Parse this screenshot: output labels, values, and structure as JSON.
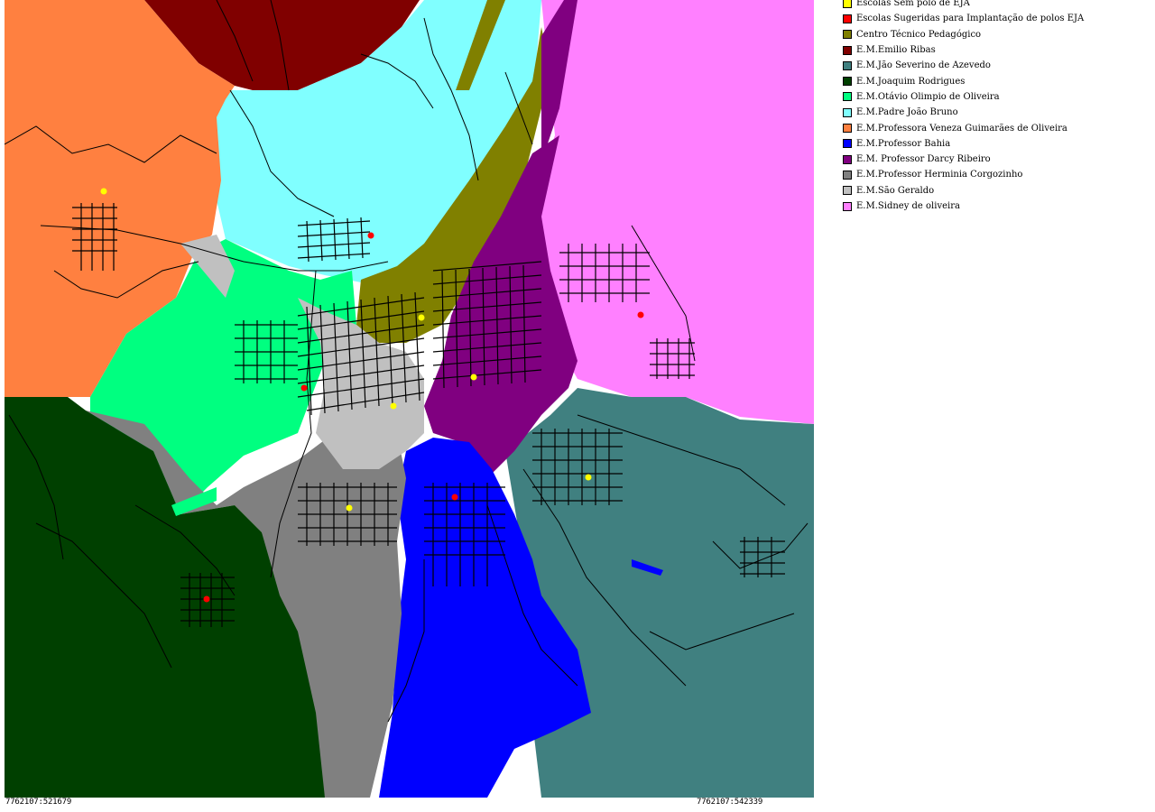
{
  "map": {
    "coord_bottom_left": "7762107:521679",
    "coord_bottom_right": "7762107:542339",
    "colors": {
      "background": "#ffffff",
      "streets": "#000000",
      "school_no_eja": "#ffff00",
      "school_suggested_eja": "#ff0000"
    }
  },
  "legend": {
    "items": [
      {
        "label": "Escolas Sem polo de EJA",
        "color": "#ffff00"
      },
      {
        "label": "Escolas Sugeridas para Implantação de polos EJA",
        "color": "#ff0000"
      },
      {
        "label": "Centro Técnico Pedagógico",
        "color": "#808000"
      },
      {
        "label": "E.M.Emilio Ribas",
        "color": "#800000"
      },
      {
        "label": "E.M.Jão Severino de Azevedo",
        "color": "#408080"
      },
      {
        "label": "E.M.Joaquim Rodrigues",
        "color": "#004000"
      },
      {
        "label": "E.M.Otávio Olimpio de Oliveira",
        "color": "#00ff80"
      },
      {
        "label": "E.M.Padre João Bruno",
        "color": "#80ffff"
      },
      {
        "label": "E.M.Professora Veneza Guimarães de Oliveira",
        "color": "#ff8040"
      },
      {
        "label": "E.M.Professor Bahia",
        "color": "#0000ff"
      },
      {
        "label": "E.M. Professor Darcy Ribeiro",
        "color": "#800080"
      },
      {
        "label": "E.M.Professor Herminia Corgozinho",
        "color": "#808080"
      },
      {
        "label": "E.M.São Geraldo",
        "color": "#c0c0c0"
      },
      {
        "label": "E.M.Sidney de oliveira",
        "color": "#ff80ff"
      }
    ]
  }
}
